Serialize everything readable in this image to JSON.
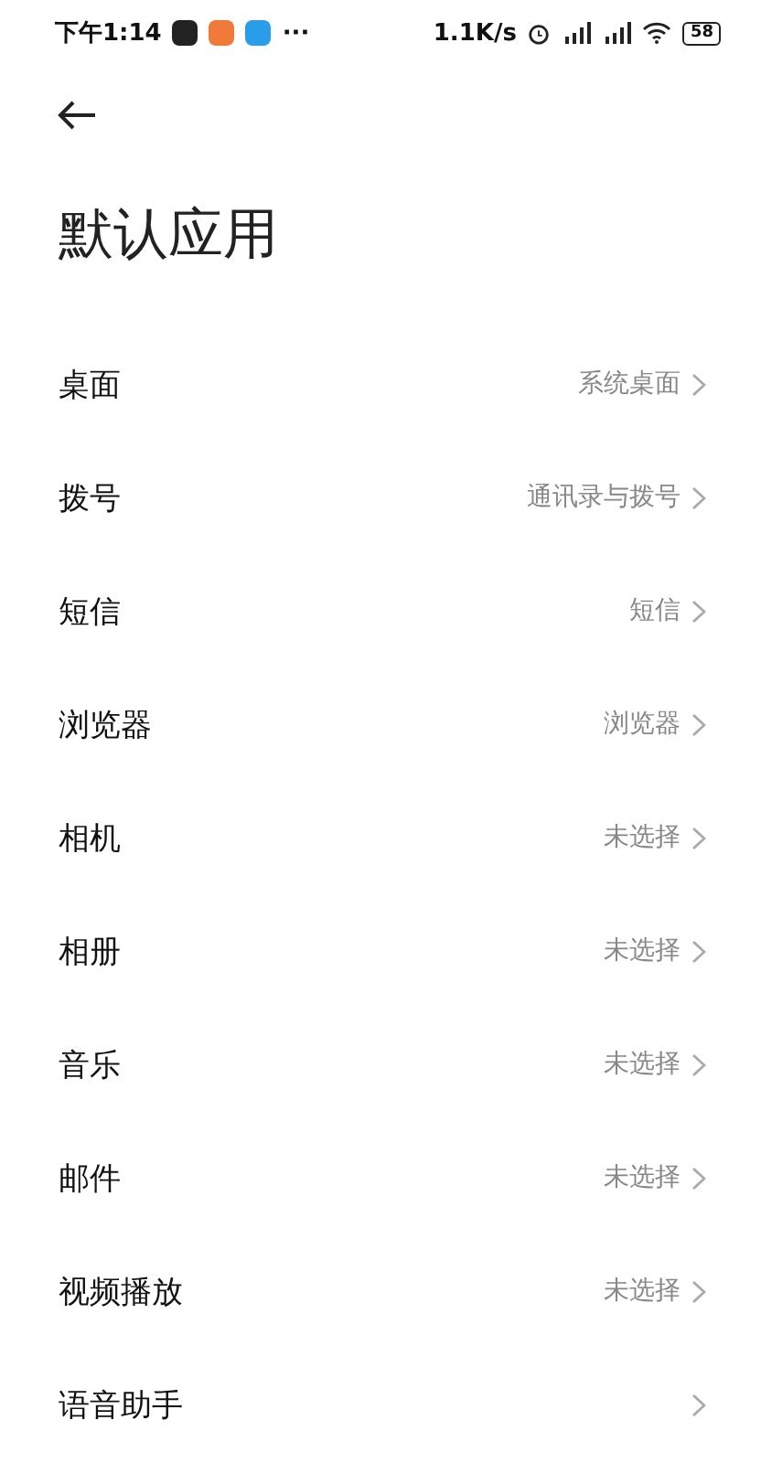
{
  "status_bar": {
    "time": "下午1:14",
    "more": "···",
    "speed": "1.1K/s",
    "battery": "58"
  },
  "title": "默认应用",
  "rows": [
    {
      "label": "桌面",
      "value": "系统桌面"
    },
    {
      "label": "拨号",
      "value": "通讯录与拨号"
    },
    {
      "label": "短信",
      "value": "短信"
    },
    {
      "label": "浏览器",
      "value": "浏览器"
    },
    {
      "label": "相机",
      "value": "未选择"
    },
    {
      "label": "相册",
      "value": "未选择"
    },
    {
      "label": "音乐",
      "value": "未选择"
    },
    {
      "label": "邮件",
      "value": "未选择"
    },
    {
      "label": "视频播放",
      "value": "未选择"
    },
    {
      "label": "语音助手"
    }
  ]
}
